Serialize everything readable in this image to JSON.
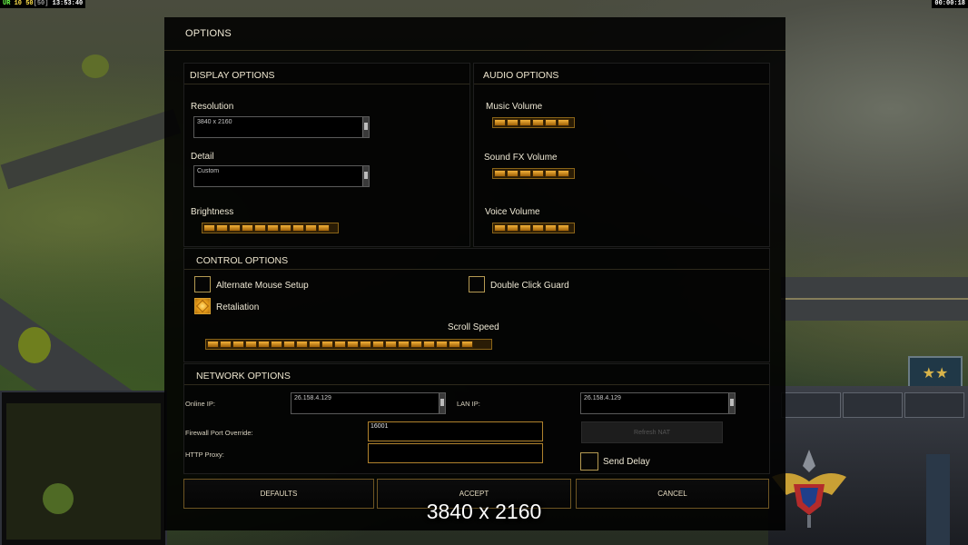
{
  "hud": {
    "ur_label": "UR",
    "ur_value": "10",
    "fps_value": "50",
    "fps_max": "[50]",
    "clock": "13:53:40",
    "game_timer": "00:00:18"
  },
  "dialog": {
    "title": "OPTIONS",
    "display": {
      "header": "DISPLAY OPTIONS",
      "resolution_label": "Resolution",
      "resolution_value": "3840 x 2160",
      "detail_label": "Detail",
      "detail_value": "Custom",
      "brightness_label": "Brightness",
      "brightness_level": 1.0
    },
    "audio": {
      "header": "AUDIO OPTIONS",
      "music_label": "Music Volume",
      "music_level": 1.0,
      "sfx_label": "Sound FX Volume",
      "sfx_level": 1.0,
      "voice_label": "Voice Volume",
      "voice_level": 1.0
    },
    "control": {
      "header": "CONTROL OPTIONS",
      "alt_mouse_label": "Alternate Mouse Setup",
      "alt_mouse_checked": false,
      "double_click_label": "Double Click Guard",
      "double_click_checked": false,
      "retaliation_label": "Retaliation",
      "retaliation_checked": true,
      "scroll_speed_label": "Scroll Speed",
      "scroll_speed_level": 1.0
    },
    "network": {
      "header": "NETWORK OPTIONS",
      "online_ip_label": "Online IP:",
      "online_ip_value": "26.158.4.129",
      "lan_ip_label": "LAN IP:",
      "lan_ip_value": "26.158.4.129",
      "firewall_label": "Firewall Port Override:",
      "firewall_value": "16001",
      "http_proxy_label": "HTTP Proxy:",
      "http_proxy_value": "",
      "refresh_nat_label": "Refresh NAT",
      "send_delay_label": "Send Delay",
      "send_delay_checked": false
    },
    "buttons": {
      "defaults": "DEFAULTS",
      "accept": "ACCEPT",
      "cancel": "CANCEL"
    }
  },
  "overlay_caption": "3840 x 2160",
  "colors": {
    "accent_gold": "#f2b23a",
    "panel_border": "#6e5523"
  }
}
